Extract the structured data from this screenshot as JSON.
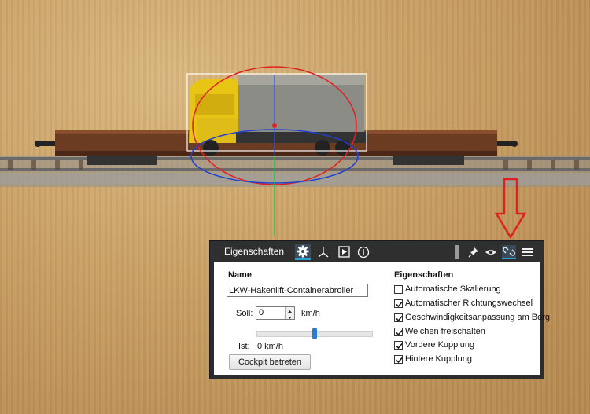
{
  "panel": {
    "title": "Eigenschaften",
    "tabs": [
      {
        "name": "settings",
        "icon": "gear-icon",
        "active": true
      },
      {
        "name": "axes",
        "icon": "axes-icon",
        "active": false
      },
      {
        "name": "play",
        "icon": "play-icon",
        "active": false
      },
      {
        "name": "info",
        "icon": "info-icon",
        "active": false
      }
    ],
    "header_buttons": [
      {
        "icon": "pin-icon"
      },
      {
        "icon": "eye-icon"
      },
      {
        "icon": "link-icon",
        "active": true
      },
      {
        "icon": "menu-icon"
      }
    ]
  },
  "left": {
    "name_heading": "Name",
    "name_value": "LKW-Hakenlift-Containerabroller",
    "soll_label": "Soll:",
    "soll_value": "0",
    "soll_unit": "km/h",
    "slider_fraction": 0.5,
    "ist_label": "Ist:",
    "ist_value": "0 km/h",
    "cockpit_button": "Cockpit betreten"
  },
  "right": {
    "heading": "Eigenschaften",
    "options": [
      {
        "label": "Automatische Skalierung",
        "checked": false
      },
      {
        "label": "Automatischer Richtungswechsel",
        "checked": true
      },
      {
        "label": "Geschwindigkeitsanpassung am Berg",
        "checked": true
      },
      {
        "label": "Weichen freischalten",
        "checked": true
      },
      {
        "label": "Vordere Kupplung",
        "checked": true
      },
      {
        "label": "Hintere Kupplung",
        "checked": true
      }
    ]
  },
  "colors": {
    "accent": "#2aa0d0",
    "arrow": "#e02020",
    "panel_dark": "#2c2c2c"
  }
}
